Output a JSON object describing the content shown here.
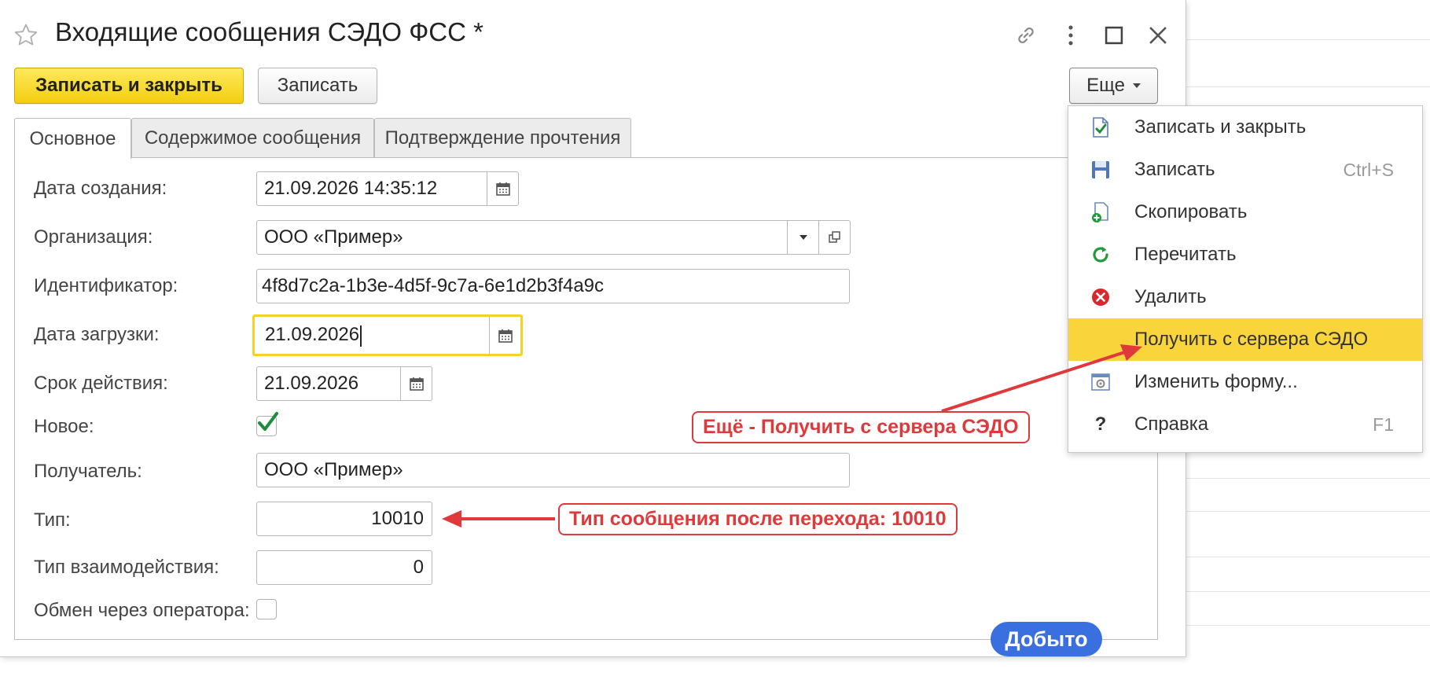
{
  "window": {
    "title": "Входящие сообщения СЭДО ФСС *"
  },
  "toolbar": {
    "save_close_label": "Записать и закрыть",
    "save_label": "Записать",
    "more_label": "Еще"
  },
  "tabs": [
    {
      "label": "Основное"
    },
    {
      "label": "Содержимое сообщения"
    },
    {
      "label": "Подтверждение прочтения"
    }
  ],
  "form": {
    "created_label": "Дата создания:",
    "created_value": "21.09.2026 14:35:12",
    "org_label": "Организация:",
    "org_value": "ООО «Пример»",
    "id_label": "Идентификатор:",
    "id_value": "4f8d7c2a-1b3e-4d5f-9c7a-6e1d2b3f4a9c",
    "loaded_label": "Дата загрузки:",
    "loaded_value": "21.09.2026",
    "expiry_label": "Срок действия:",
    "expiry_value": "21.09.2026",
    "new_label": "Новое:",
    "new_checked": true,
    "recipient_label": "Получатель:",
    "recipient_value": "ООО «Пример»",
    "type_label": "Тип:",
    "type_value": "10010",
    "interaction_label": "Тип взаимодействия:",
    "interaction_value": "0",
    "operator_label": "Обмен через оператора:",
    "operator_checked": false
  },
  "menu": {
    "items": [
      {
        "label": "Записать и закрыть",
        "shortcut": "",
        "icon": "doc-check-icon"
      },
      {
        "label": "Записать",
        "shortcut": "Ctrl+S",
        "icon": "floppy-disk-icon"
      },
      {
        "label": "Скопировать",
        "shortcut": "",
        "icon": "copy-doc-icon"
      },
      {
        "label": "Перечитать",
        "shortcut": "",
        "icon": "refresh-icon"
      },
      {
        "label": "Удалить",
        "shortcut": "",
        "icon": "delete-icon"
      },
      {
        "label": "Получить с сервера СЭДО",
        "shortcut": "",
        "icon": "",
        "highlighted": true
      },
      {
        "label": "Изменить форму...",
        "shortcut": "",
        "icon": "form-settings-icon"
      },
      {
        "label": "Справка",
        "shortcut": "F1",
        "icon": "help-icon"
      }
    ]
  },
  "annotations": {
    "menu_callout": "Ещё - Получить с сервера СЭДО",
    "type_callout": "Тип сообщения после перехода: 10010",
    "badge": "Добыто"
  },
  "colors": {
    "primary_button": "#f2ce10",
    "menu_highlight": "#f9d43a",
    "focus_border": "#f5d326",
    "annotation_red": "#e0393b",
    "badge_blue": "#3a6fe0",
    "check_green": "#1e8c3a"
  }
}
